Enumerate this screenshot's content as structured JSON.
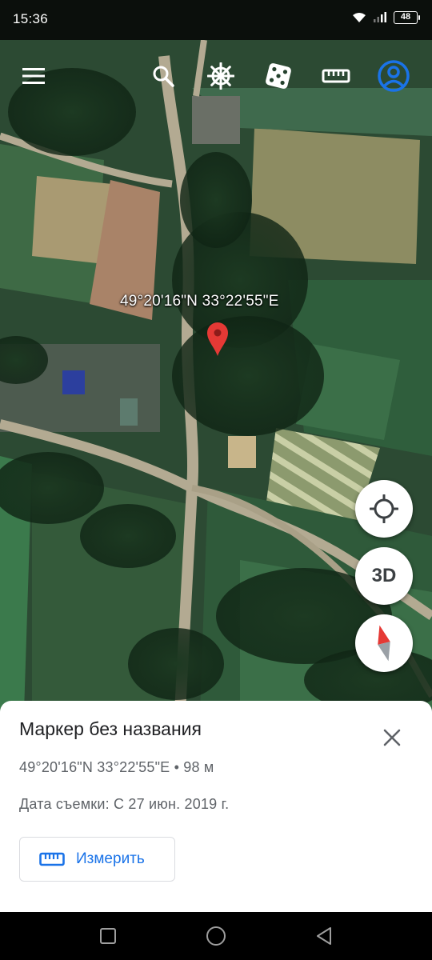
{
  "status_bar": {
    "time": "15:36",
    "battery": "48"
  },
  "toolbar": {
    "icons": [
      "menu-icon",
      "search-icon",
      "voyager-wheel-icon",
      "feeling-lucky-dice-icon",
      "measure-ruler-icon",
      "account-icon"
    ]
  },
  "map": {
    "coordinate_label": "49°20'16\"N 33°22'55\"E",
    "marker_color": "#e53935",
    "three_d_label": "3D"
  },
  "sheet": {
    "title": "Маркер без названия",
    "coords": "49°20'16\"N 33°22'55\"E • 98 м",
    "capture_date": "Дата съемки: С 27 июн. 2019 г.",
    "measure_label": "Измерить"
  },
  "colors": {
    "accent": "#1a73e8",
    "pin": "#e53935"
  }
}
